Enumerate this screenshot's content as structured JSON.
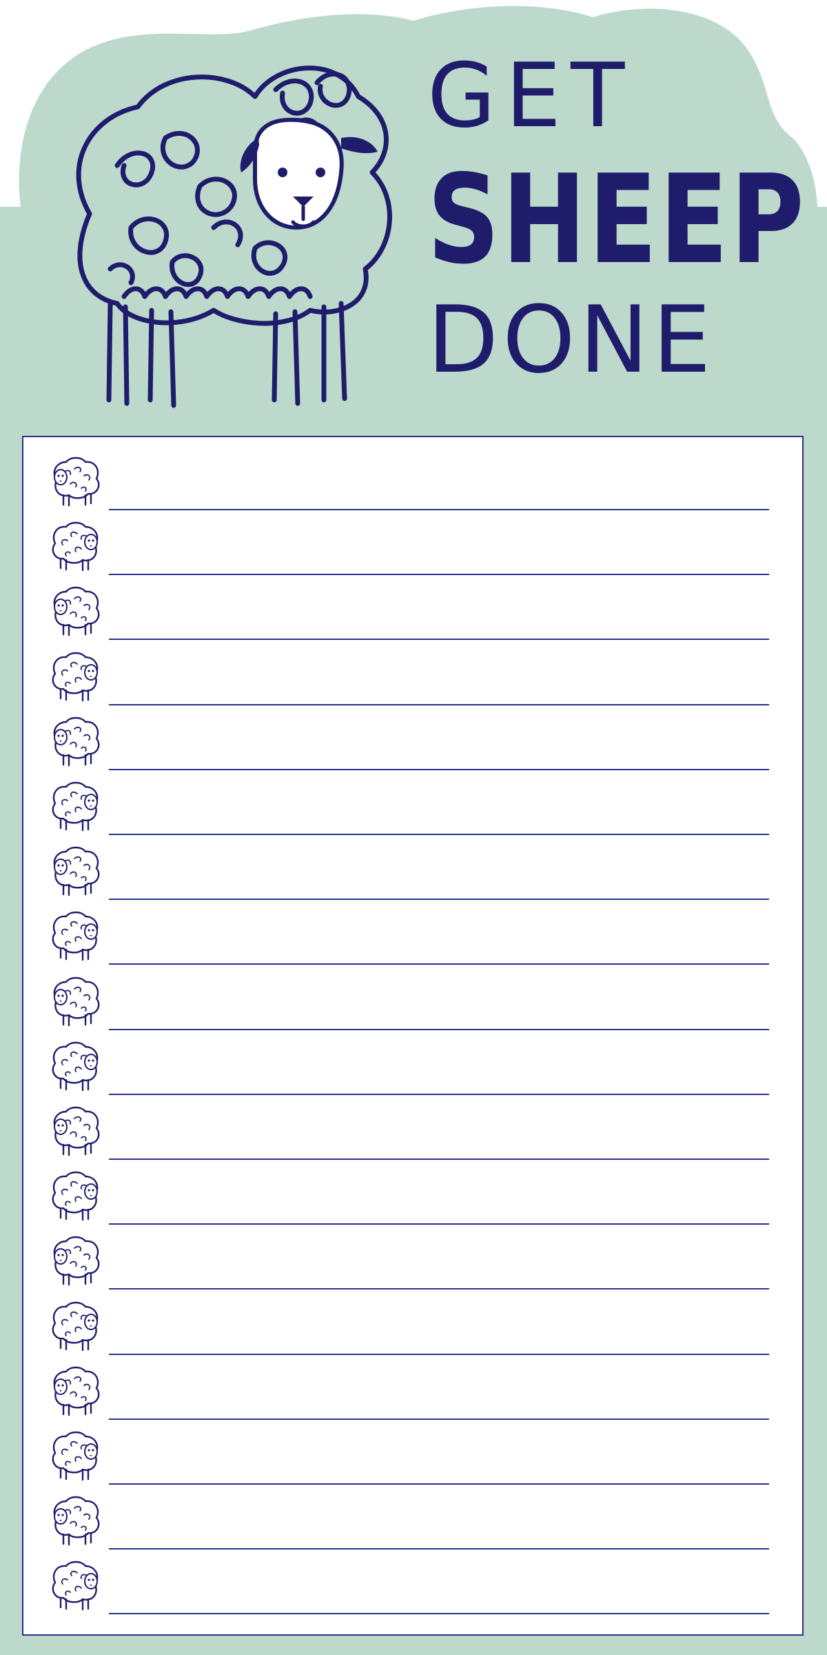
{
  "header": {
    "title_lines": [
      "GET",
      "SHEEP",
      "DONE"
    ]
  },
  "colors": {
    "background_mint": "#bcd9cc",
    "ink_navy": "#1f1d6b",
    "rule_blue": "#2c2f8f",
    "paper": "#ffffff"
  },
  "icons": {
    "hero": "sheep-illustration-icon",
    "row": "small-sheep-icon"
  },
  "list": {
    "rows": [
      {
        "icon": "sheep-icon"
      },
      {
        "icon": "sheep-icon"
      },
      {
        "icon": "sheep-icon"
      },
      {
        "icon": "sheep-icon"
      },
      {
        "icon": "sheep-icon"
      },
      {
        "icon": "sheep-icon"
      },
      {
        "icon": "sheep-icon"
      },
      {
        "icon": "sheep-icon"
      },
      {
        "icon": "sheep-icon"
      },
      {
        "icon": "sheep-icon"
      },
      {
        "icon": "sheep-icon"
      },
      {
        "icon": "sheep-icon"
      },
      {
        "icon": "sheep-icon"
      },
      {
        "icon": "sheep-icon"
      },
      {
        "icon": "sheep-icon"
      },
      {
        "icon": "sheep-icon"
      },
      {
        "icon": "sheep-icon"
      },
      {
        "icon": "sheep-icon"
      }
    ]
  }
}
